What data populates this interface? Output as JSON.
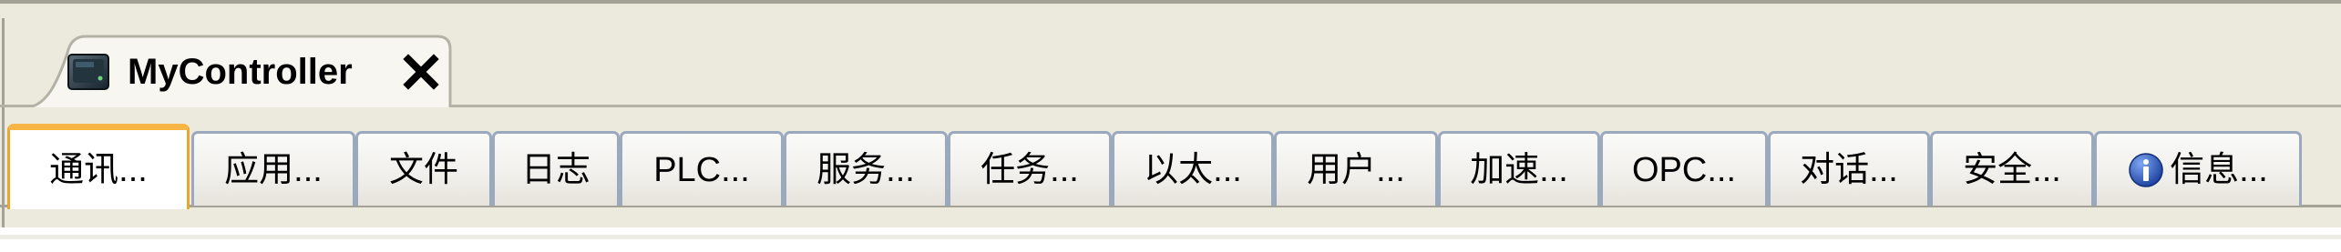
{
  "document_tab": {
    "title": "MyController",
    "icon": "controller-device-icon",
    "close_icon": "close-icon"
  },
  "subtabs": [
    {
      "label": "通讯...",
      "active": true
    },
    {
      "label": "应用...",
      "active": false
    },
    {
      "label": "文件",
      "active": false
    },
    {
      "label": "日志",
      "active": false
    },
    {
      "label": "PLC...",
      "active": false
    },
    {
      "label": "服务...",
      "active": false
    },
    {
      "label": "任务...",
      "active": false
    },
    {
      "label": "以太...",
      "active": false
    },
    {
      "label": "用户...",
      "active": false
    },
    {
      "label": "加速...",
      "active": false
    },
    {
      "label": "OPC...",
      "active": false
    },
    {
      "label": "对话...",
      "active": false
    },
    {
      "label": "安全...",
      "active": false
    },
    {
      "label": "信息...",
      "active": false,
      "icon": "info-icon"
    }
  ],
  "colors": {
    "active_tab_accent": "#f6b545",
    "tab_border": "#9aa9bd",
    "frame_background": "#ece9dd",
    "info_icon_blue": "#1f4fb3"
  }
}
